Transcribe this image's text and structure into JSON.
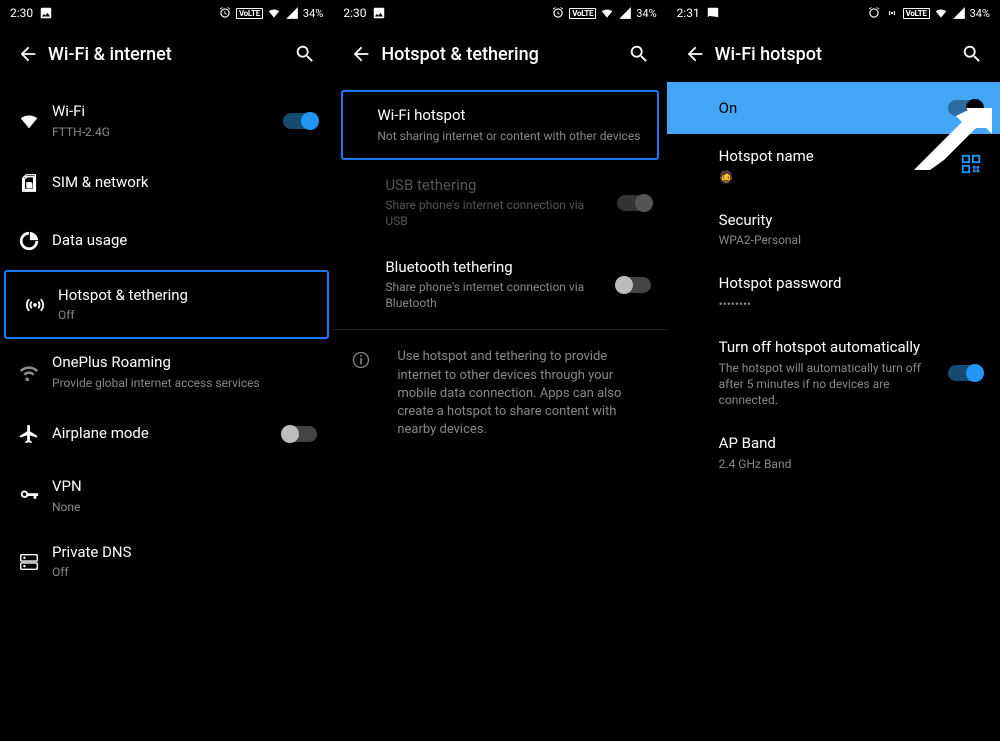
{
  "statusbar": {
    "time_a": "2:30",
    "time_c": "2:31",
    "volte": "VoLTE",
    "battery": "34%"
  },
  "screen1": {
    "title": "Wi-Fi & internet",
    "items": {
      "wifi": {
        "title": "Wi-Fi",
        "sub": "FTTH-2.4G"
      },
      "sim": {
        "title": "SIM & network"
      },
      "data": {
        "title": "Data usage"
      },
      "hotspot": {
        "title": "Hotspot & tethering",
        "sub": "Off"
      },
      "roaming": {
        "title": "OnePlus Roaming",
        "sub": "Provide global internet access services"
      },
      "airplane": {
        "title": "Airplane mode"
      },
      "vpn": {
        "title": "VPN",
        "sub": "None"
      },
      "dns": {
        "title": "Private DNS",
        "sub": "Off"
      }
    }
  },
  "screen2": {
    "title": "Hotspot & tethering",
    "items": {
      "wifi_hotspot": {
        "title": "Wi-Fi hotspot",
        "sub": "Not sharing internet or content with other devices"
      },
      "usb": {
        "title": "USB tethering",
        "sub": "Share phone's internet connection via USB"
      },
      "bt": {
        "title": "Bluetooth tethering",
        "sub": "Share phone's internet connection via Bluetooth"
      }
    },
    "info": "Use hotspot and tethering to provide internet to other devices through your mobile data connection. Apps can also create a hotspot to share content with nearby devices."
  },
  "screen3": {
    "title": "Wi-Fi hotspot",
    "on_label": "On",
    "items": {
      "name": {
        "title": "Hotspot name",
        "sub": "🧔"
      },
      "security": {
        "title": "Security",
        "sub": "WPA2-Personal"
      },
      "password": {
        "title": "Hotspot password",
        "sub": "••••••••"
      },
      "auto_off": {
        "title": "Turn off hotspot automatically",
        "sub": "The hotspot will automatically turn off after 5 minutes if no devices are connected."
      },
      "band": {
        "title": "AP Band",
        "sub": "2.4 GHz Band"
      }
    }
  }
}
